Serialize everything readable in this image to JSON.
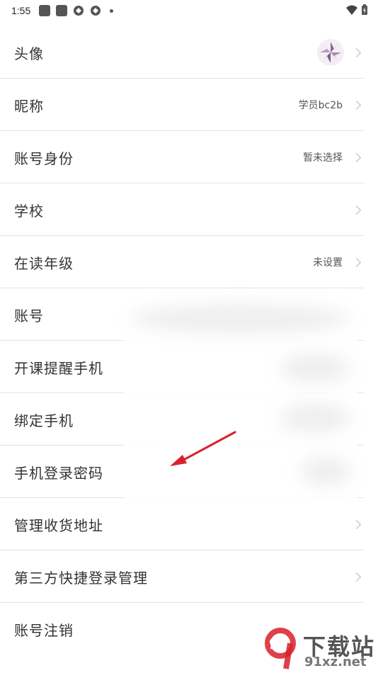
{
  "status_bar": {
    "time": "1:55",
    "icons": [
      "square-app-icon",
      "square-app-icon",
      "sync-icon",
      "sync-icon",
      "dot-icon"
    ],
    "right_icons": [
      "wifi-icon",
      "battery-icon"
    ]
  },
  "settings": {
    "items": [
      {
        "label": "头像",
        "value": "",
        "has_avatar": true
      },
      {
        "label": "昵称",
        "value": "学员bc2b"
      },
      {
        "label": "账号身份",
        "value": "暂未选择"
      },
      {
        "label": "学校",
        "value": ""
      },
      {
        "label": "在读年级",
        "value": "未设置"
      },
      {
        "label": "账号",
        "value": ""
      },
      {
        "label": "开课提醒手机",
        "value": ""
      },
      {
        "label": "绑定手机",
        "value": ""
      },
      {
        "label": "手机登录密码",
        "value": ""
      },
      {
        "label": "管理收货地址",
        "value": ""
      },
      {
        "label": "第三方快捷登录管理",
        "value": ""
      },
      {
        "label": "账号注销",
        "value": ""
      }
    ]
  },
  "watermark": {
    "text": "下载站",
    "sub": "91xz.net",
    "logo": "9"
  },
  "colors": {
    "arrow": "#d9202a",
    "divider": "#e3e3e3",
    "label": "#333333"
  }
}
